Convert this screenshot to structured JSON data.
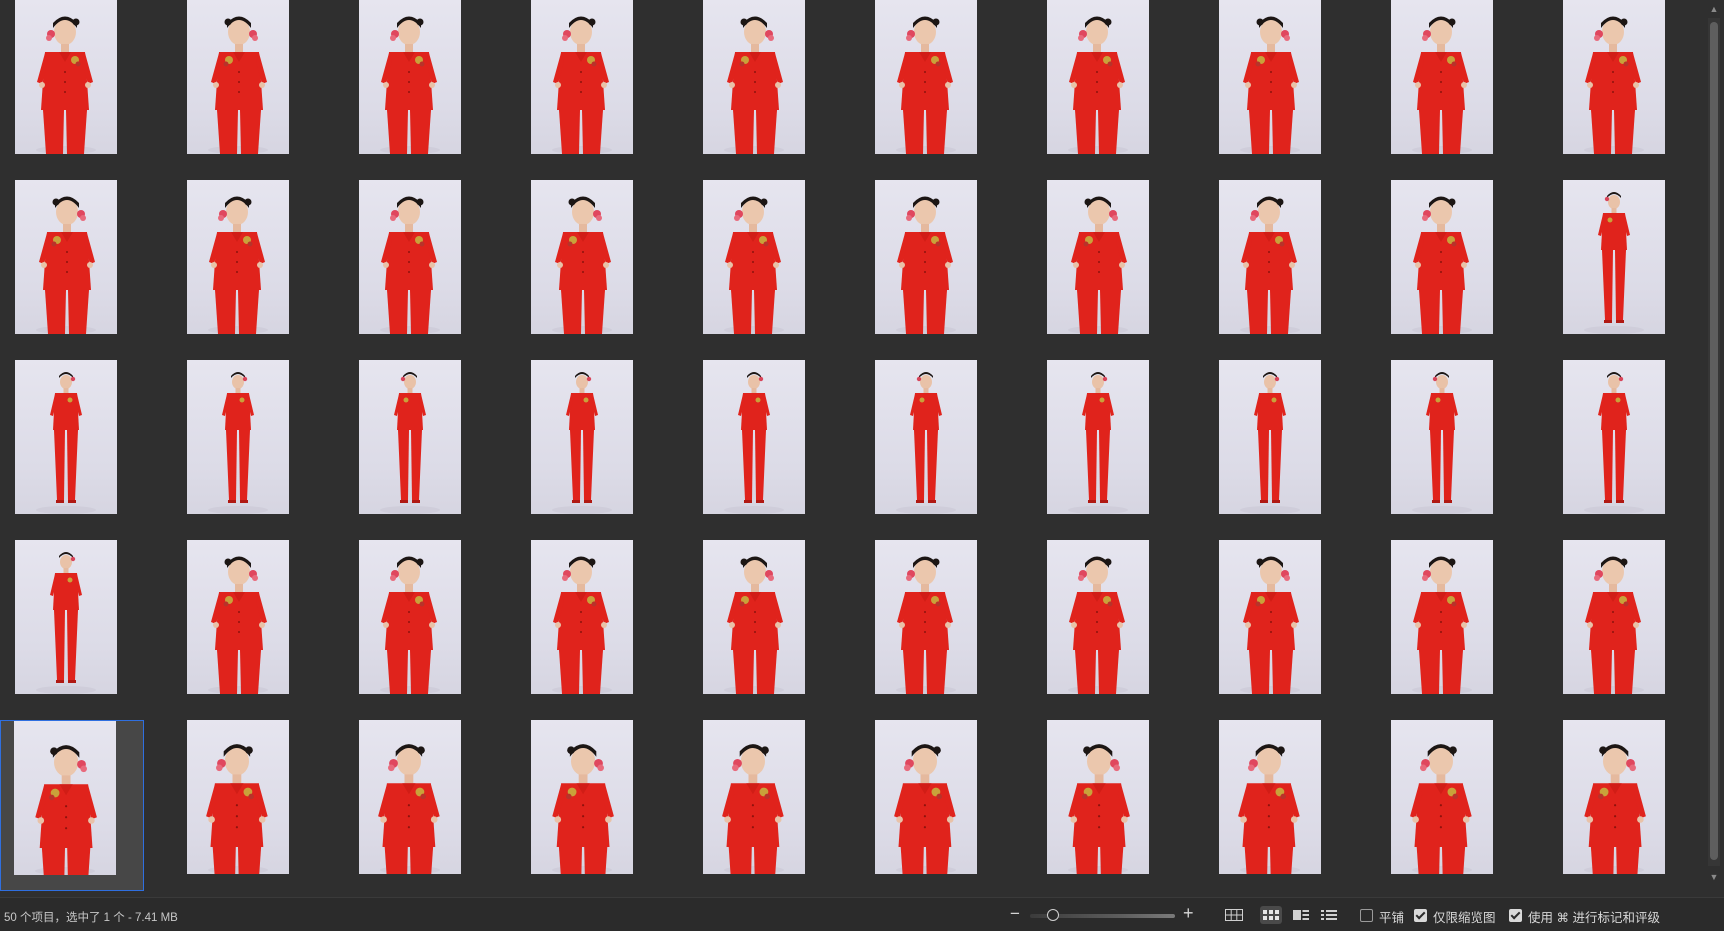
{
  "status": {
    "summary": "50 个项目，选中了 1 个 - 7.41 MB"
  },
  "zoom": {
    "minus_label": "−",
    "plus_label": "+",
    "level": 0.15
  },
  "view_modes": [
    {
      "name": "grid-view",
      "active": false
    },
    {
      "name": "thumbnail-view",
      "active": true
    },
    {
      "name": "filmstrip-view",
      "active": false
    },
    {
      "name": "list-view",
      "active": false
    }
  ],
  "options": {
    "tile": {
      "label": "平铺",
      "checked": false
    },
    "thumbnails_only": {
      "label": "仅限缩览图",
      "checked": true
    },
    "cmd_rate": {
      "label": "使用 ⌘ 进行标记和评级",
      "checked": true
    }
  },
  "gallery": {
    "item_count": 50,
    "selected_index": 40,
    "items": [
      "h",
      "h",
      "h",
      "h",
      "h",
      "h",
      "h",
      "h",
      "h",
      "h",
      "h",
      "h",
      "h",
      "h",
      "h",
      "h",
      "h",
      "h",
      "h",
      "f",
      "f",
      "f",
      "f",
      "f",
      "f",
      "f",
      "f",
      "f",
      "f",
      "f",
      "f",
      "h",
      "h",
      "h",
      "h",
      "h",
      "h",
      "h",
      "h",
      "h",
      "c",
      "c",
      "c",
      "c",
      "c",
      "c",
      "c",
      "c",
      "c",
      "c"
    ]
  },
  "colors": {
    "background": "#2f2f2f",
    "selection_border": "#2f6fe0",
    "outfit_red": "#e0231c"
  }
}
